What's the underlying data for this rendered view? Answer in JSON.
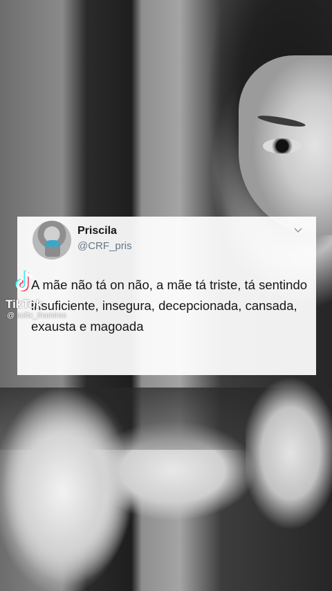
{
  "tweet": {
    "name": "Priscila",
    "handle": "@CRF_pris",
    "text": "A mãe não tá on não, a mãe tá triste, tá sentindo insuficiente, insegura, decepcionada, cansada, exausta e magoada"
  },
  "watermark": {
    "brand": "TikTok",
    "username": "@ softx_thamires"
  },
  "icons": {
    "menu": "chevron-down-icon",
    "logo": "tiktok-logo-icon"
  }
}
